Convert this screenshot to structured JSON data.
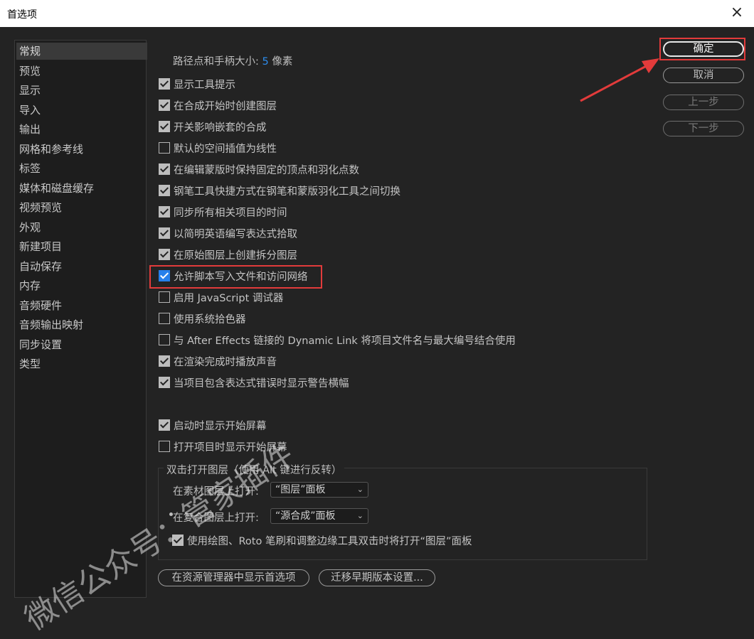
{
  "window": {
    "title": "首选项",
    "close_icon": "×"
  },
  "sidebar": {
    "items": [
      "常规",
      "预览",
      "显示",
      "导入",
      "输出",
      "网格和参考线",
      "标签",
      "媒体和磁盘缓存",
      "视频预览",
      "外观",
      "新建项目",
      "自动保存",
      "内存",
      "音频硬件",
      "音频输出映射",
      "同步设置",
      "类型"
    ],
    "active": "常规"
  },
  "general": {
    "path_label": "路径点和手柄大小:",
    "path_value": "5",
    "path_unit": "像素",
    "options": [
      {
        "label": "显示工具提示",
        "checked": true
      },
      {
        "label": "在合成开始时创建图层",
        "checked": true
      },
      {
        "label": "开关影响嵌套的合成",
        "checked": true
      },
      {
        "label": "默认的空间插值为线性",
        "checked": false
      },
      {
        "label": "在编辑蒙版时保持固定的顶点和羽化点数",
        "checked": true
      },
      {
        "label": "钢笔工具快捷方式在钢笔和蒙版羽化工具之间切换",
        "checked": true
      },
      {
        "label": "同步所有相关项目的时间",
        "checked": true
      },
      {
        "label": "以简明英语编写表达式拾取",
        "checked": true
      },
      {
        "label": "在原始图层上创建拆分图层",
        "checked": true
      },
      {
        "label": "允许脚本写入文件和访问网络",
        "checked": true
      },
      {
        "label": "启用 JavaScript 调试器",
        "checked": false
      },
      {
        "label": "使用系统拾色器",
        "checked": false
      },
      {
        "label": "与 After Effects 链接的 Dynamic Link 将项目文件名与最大编号结合使用",
        "checked": false
      },
      {
        "label": "在渲染完成时播放声音",
        "checked": true
      },
      {
        "label": "当项目包含表达式错误时显示警告横幅",
        "checked": true
      }
    ],
    "startup": [
      {
        "label": "启动时显示开始屏幕",
        "checked": true
      },
      {
        "label": "打开项目时显示开始屏幕",
        "checked": false
      }
    ],
    "double_click": {
      "title": "双击打开图层（使用 Alt 键进行反转）",
      "footage_label": "在素材图层上打开:",
      "footage_value": "“图层”面板",
      "comp_label": "在复合图层上打开:",
      "comp_value": "“源合成”面板",
      "paint_label": "使用绘图、Roto 笔刷和调整边缘工具双击时将打开“图层”面板",
      "paint_checked": true
    },
    "reveal_button": "在资源管理器中显示首选项",
    "migrate_button": "迁移早期版本设置..."
  },
  "buttons": {
    "ok": "确定",
    "cancel": "取消",
    "prev": "上一步",
    "next": "下一步"
  },
  "watermark": "微信公众号：管家插件",
  "colors": {
    "highlight": "#e23b3b",
    "value": "#2d8ceb"
  }
}
